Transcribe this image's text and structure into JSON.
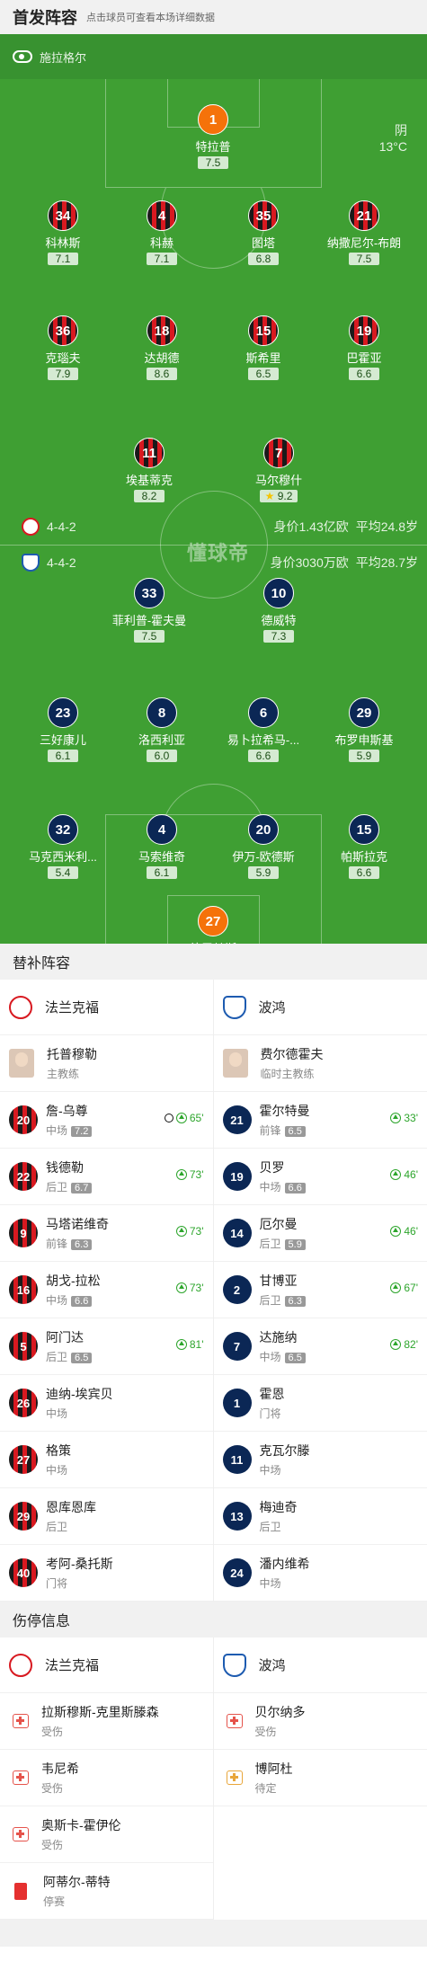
{
  "header": {
    "title": "首发阵容",
    "hint": "点击球员可查看本场详细数据"
  },
  "referee": "施拉格尔",
  "weather": {
    "condition": "阴",
    "temp": "13°C"
  },
  "home": {
    "formation": "4-4-2",
    "value": "身价1.43亿欧",
    "age": "平均24.8岁",
    "color": "#d81920"
  },
  "away": {
    "formation": "4-4-2",
    "value": "身价3030万欧",
    "age": "平均28.7岁",
    "color": "#0b2755"
  },
  "watermark": "懂球帝",
  "players": [
    {
      "num": "1",
      "name": "特拉普",
      "rating": "7.5",
      "side": "gk",
      "captain": true
    },
    {
      "num": "34",
      "name": "科林斯",
      "rating": "7.1",
      "side": "home"
    },
    {
      "num": "4",
      "name": "科赫",
      "rating": "7.1",
      "side": "home",
      "sub": "73'"
    },
    {
      "num": "35",
      "name": "图塔",
      "rating": "6.8",
      "side": "home",
      "sub": "81'"
    },
    {
      "num": "21",
      "name": "纳撒尼尔-布朗",
      "rating": "7.5",
      "side": "home"
    },
    {
      "num": "36",
      "name": "克瑙夫",
      "rating": "7.9",
      "side": "home",
      "yellow": true,
      "goals": 1
    },
    {
      "num": "18",
      "name": "达胡德",
      "rating": "8.6",
      "side": "home",
      "goals": 2
    },
    {
      "num": "15",
      "name": "斯希里",
      "rating": "6.5",
      "side": "home",
      "sub": "73'"
    },
    {
      "num": "19",
      "name": "巴霍亚",
      "rating": "6.6",
      "side": "home",
      "sub": "65'"
    },
    {
      "num": "11",
      "name": "埃基蒂克",
      "rating": "8.2",
      "side": "home",
      "goals": 2
    },
    {
      "num": "7",
      "name": "马尔穆什",
      "rating": "9.2",
      "side": "home",
      "sub": "73'",
      "goals": 3,
      "star": true
    },
    {
      "num": "33",
      "name": "菲利普-霍夫曼",
      "rating": "7.5",
      "side": "away",
      "sub": "82'",
      "yellow": true,
      "goals": 1
    },
    {
      "num": "10",
      "name": "德威特",
      "rating": "7.3",
      "side": "away",
      "goals": 1
    },
    {
      "num": "23",
      "name": "三好康儿",
      "rating": "6.1",
      "side": "away",
      "sub": "46'"
    },
    {
      "num": "8",
      "name": "洛西利亚",
      "rating": "6.0",
      "side": "away",
      "captain": true
    },
    {
      "num": "6",
      "name": "易卜拉希马-...",
      "rating": "6.6",
      "side": "away"
    },
    {
      "num": "29",
      "name": "布罗申斯基",
      "rating": "5.9",
      "side": "away",
      "sub": "46'"
    },
    {
      "num": "32",
      "name": "马克西米利...",
      "rating": "5.4",
      "side": "away",
      "sub": "33'"
    },
    {
      "num": "4",
      "name": "马索维奇",
      "rating": "6.1",
      "side": "away",
      "goals": 1
    },
    {
      "num": "20",
      "name": "伊万-欧德斯",
      "rating": "5.9",
      "side": "away",
      "yellow": true
    },
    {
      "num": "15",
      "name": "帕斯拉克",
      "rating": "6.6",
      "side": "away",
      "sub": "67'"
    },
    {
      "num": "27",
      "name": "德雷赫斯",
      "rating": "5.5",
      "side": "gk"
    }
  ],
  "subs": {
    "title": "替补阵容",
    "home_team": "法兰克福",
    "away_team": "波鸿",
    "home_coach": {
      "name": "托普穆勒",
      "role": "主教练"
    },
    "away_coach": {
      "name": "费尔德霍夫",
      "role": "临时主教练"
    },
    "home": [
      {
        "num": "20",
        "name": "詹-乌尊",
        "pos": "中场",
        "rating": "7.2",
        "time": "65'",
        "goal": true
      },
      {
        "num": "22",
        "name": "钱德勒",
        "pos": "后卫",
        "rating": "6.7",
        "time": "73'"
      },
      {
        "num": "9",
        "name": "马塔诺维奇",
        "pos": "前锋",
        "rating": "6.3",
        "time": "73'"
      },
      {
        "num": "16",
        "name": "胡戈-拉松",
        "pos": "中场",
        "rating": "6.6",
        "time": "73'"
      },
      {
        "num": "5",
        "name": "阿门达",
        "pos": "后卫",
        "rating": "6.5",
        "time": "81'"
      },
      {
        "num": "26",
        "name": "迪纳-埃宾贝",
        "pos": "中场"
      },
      {
        "num": "27",
        "name": "格策",
        "pos": "中场"
      },
      {
        "num": "29",
        "name": "恩库恩库",
        "pos": "后卫"
      },
      {
        "num": "40",
        "name": "考阿-桑托斯",
        "pos": "门将"
      }
    ],
    "away": [
      {
        "num": "21",
        "name": "霍尔特曼",
        "pos": "前锋",
        "rating": "6.5",
        "time": "33'"
      },
      {
        "num": "19",
        "name": "贝罗",
        "pos": "中场",
        "rating": "6.6",
        "time": "46'"
      },
      {
        "num": "14",
        "name": "厄尔曼",
        "pos": "后卫",
        "rating": "5.9",
        "time": "46'"
      },
      {
        "num": "2",
        "name": "甘博亚",
        "pos": "后卫",
        "rating": "6.3",
        "time": "67'"
      },
      {
        "num": "7",
        "name": "达施纳",
        "pos": "中场",
        "rating": "6.5",
        "time": "82'"
      },
      {
        "num": "1",
        "name": "霍恩",
        "pos": "门将"
      },
      {
        "num": "11",
        "name": "克瓦尔滕",
        "pos": "中场"
      },
      {
        "num": "13",
        "name": "梅迪奇",
        "pos": "后卫"
      },
      {
        "num": "24",
        "name": "潘内维希",
        "pos": "中场"
      }
    ]
  },
  "injuries": {
    "title": "伤停信息",
    "home_team": "法兰克福",
    "away_team": "波鸿",
    "home": [
      {
        "name": "拉斯穆斯-克里斯滕森",
        "status": "受伤",
        "icon": "medic"
      },
      {
        "name": "韦尼希",
        "status": "受伤",
        "icon": "medic"
      },
      {
        "name": "奥斯卡-霍伊伦",
        "status": "受伤",
        "icon": "medic"
      },
      {
        "name": "阿蒂尔-蒂特",
        "status": "停赛",
        "icon": "red-card"
      }
    ],
    "away": [
      {
        "name": "贝尔纳多",
        "status": "受伤",
        "icon": "medic"
      },
      {
        "name": "博阿杜",
        "status": "待定",
        "icon": "medic-pending"
      }
    ]
  }
}
